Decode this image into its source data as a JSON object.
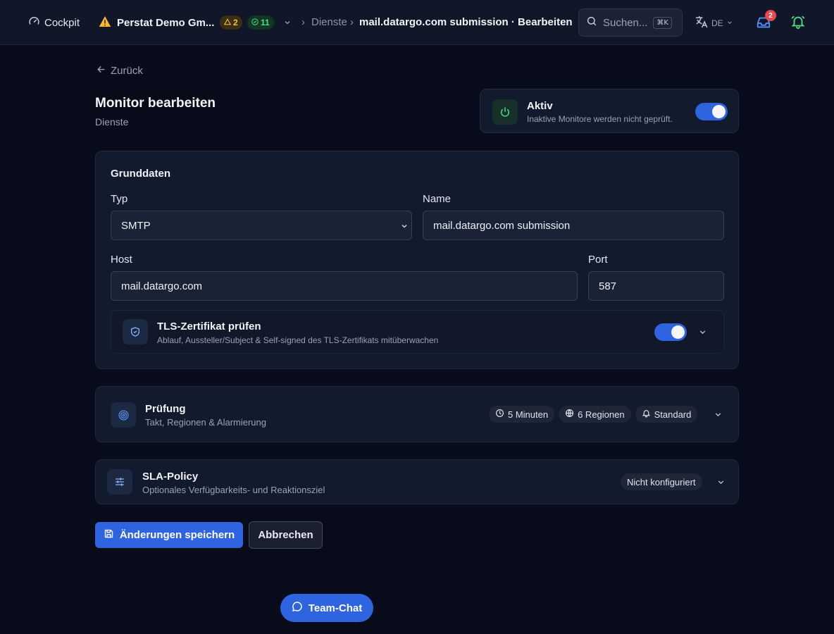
{
  "topbar": {
    "cockpit_label": "Cockpit",
    "org_name": "Perstat Demo Gm...",
    "warning_count": "2",
    "ok_count": "11",
    "breadcrumb_parent": "Dienste",
    "breadcrumb_current": "mail.datargo.com submission · Bearbeiten",
    "search_placeholder": "Suchen...",
    "search_shortcut": "⌘K",
    "language": "DE",
    "inbox_badge": "2"
  },
  "page": {
    "back_label": "Zurück",
    "title": "Monitor bearbeiten",
    "subtitle": "Dienste"
  },
  "active_card": {
    "title": "Aktiv",
    "description": "Inaktive Monitore werden nicht geprüft.",
    "enabled": true
  },
  "grunddaten": {
    "heading": "Grunddaten",
    "typ_label": "Typ",
    "typ_value": "SMTP",
    "name_label": "Name",
    "name_value": "mail.datargo.com submission",
    "host_label": "Host",
    "host_value": "mail.datargo.com",
    "port_label": "Port",
    "port_value": "587",
    "tls_title": "TLS-Zertifikat prüfen",
    "tls_description": "Ablauf, Aussteller/Subject & Self-signed des TLS-Zertifikats mitüberwachen",
    "tls_enabled": true
  },
  "pruefung": {
    "title": "Prüfung",
    "description": "Takt, Regionen & Alarmierung",
    "chip_interval": "5 Minuten",
    "chip_regions": "6 Regionen",
    "chip_alert": "Standard"
  },
  "sla": {
    "title": "SLA-Policy",
    "description": "Optionales Verfügbarkeits- und Reaktionsziel",
    "status": "Nicht konfiguriert"
  },
  "actions": {
    "save_label": "Änderungen speichern",
    "cancel_label": "Abbrechen"
  },
  "chat": {
    "label": "Team-Chat"
  },
  "colors": {
    "accent": "#2f64e0",
    "background": "#080b19",
    "card": "#121a2d",
    "warning": "#f5c542",
    "success": "#4ade80",
    "danger": "#e5484d"
  }
}
